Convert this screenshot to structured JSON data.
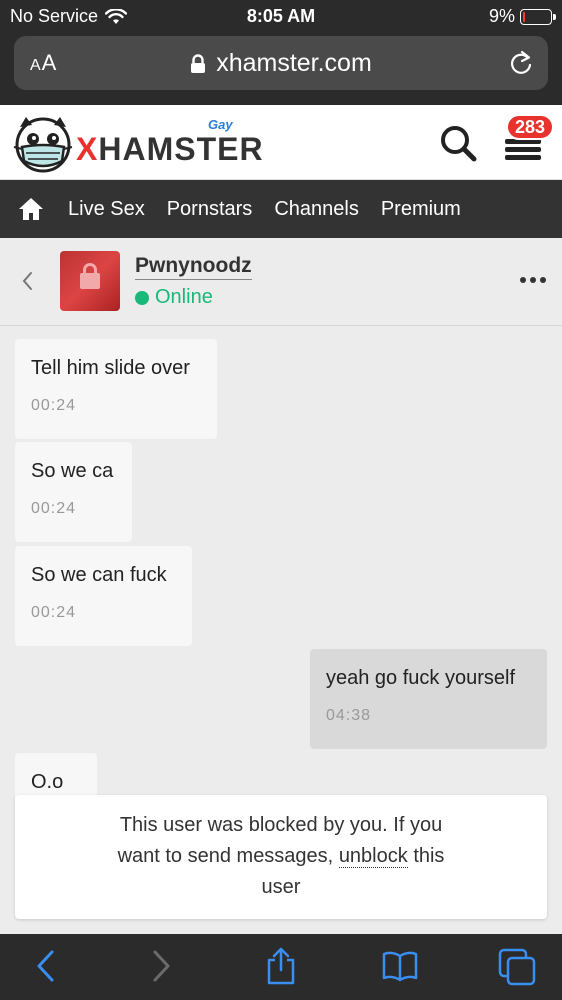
{
  "status_bar": {
    "carrier": "No Service",
    "time": "8:05 AM",
    "battery_percent": "9%",
    "battery_level": 0.09
  },
  "browser": {
    "aa_label": "AA",
    "url": "xhamster.com"
  },
  "site": {
    "brand_x": "X",
    "brand_rest": "HAMSTER",
    "brand_tag": "Gay",
    "notifications": "283",
    "accent": "#e8322d"
  },
  "nav": {
    "items": [
      "Live Sex",
      "Pornstars",
      "Channels",
      "Premium"
    ]
  },
  "chat": {
    "username": "Pwnynoodz",
    "status": "Online",
    "status_color": "#18b87a",
    "messages": [
      {
        "text": "Tell him slide over",
        "time": "00:24",
        "direction": "in"
      },
      {
        "text": "So we ca",
        "time": "00:24",
        "direction": "in"
      },
      {
        "text": "So we can fuck",
        "time": "00:24",
        "direction": "in"
      },
      {
        "text": "yeah go fuck yourself",
        "time": "04:38",
        "direction": "out"
      },
      {
        "text": "O.o",
        "time": "",
        "direction": "in"
      }
    ],
    "blocked_notice": {
      "line1": "This user was blocked by you. If you",
      "line2_before": "want to send messages,",
      "link": "unblock",
      "line2_after": "this",
      "line3": "user"
    }
  },
  "icons": {
    "wifi": "wifi-icon",
    "lock": "lock-icon",
    "reload": "reload-icon",
    "search": "search-icon",
    "menu": "hamburger-menu-icon",
    "home": "home-icon",
    "back": "chevron-left-icon",
    "more": "more-dots-icon",
    "share": "share-icon",
    "bookmarks": "bookmarks-icon",
    "tabs": "tabs-icon"
  }
}
